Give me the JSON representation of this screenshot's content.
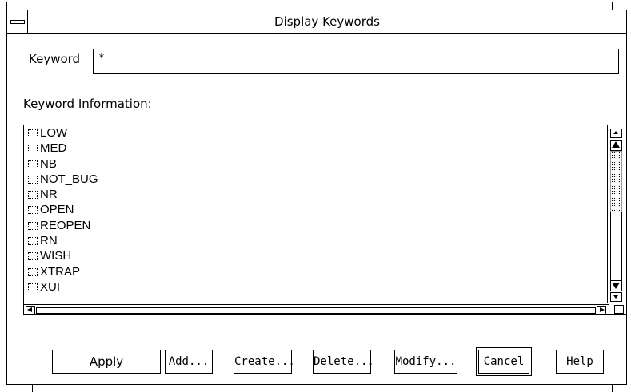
{
  "window": {
    "title": "Display Keywords"
  },
  "keyword": {
    "label": "Keyword",
    "value": "*"
  },
  "info": {
    "label": "Keyword Information:"
  },
  "list": {
    "items": [
      {
        "label": "LOW"
      },
      {
        "label": "MED"
      },
      {
        "label": "NB"
      },
      {
        "label": "NOT_BUG"
      },
      {
        "label": "NR"
      },
      {
        "label": "OPEN"
      },
      {
        "label": "REOPEN"
      },
      {
        "label": "RN"
      },
      {
        "label": "WISH"
      },
      {
        "label": "XTRAP"
      },
      {
        "label": "XUI"
      }
    ]
  },
  "buttons": {
    "apply": "Apply",
    "add": "Add...",
    "create": "Create...",
    "delete": "Delete...",
    "modify": "Modify...",
    "cancel": "Cancel",
    "help": "Help"
  }
}
